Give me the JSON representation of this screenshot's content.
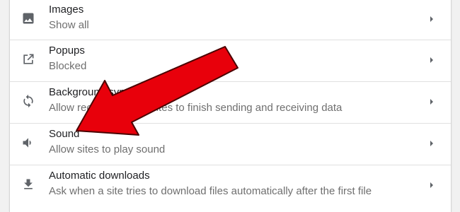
{
  "settings": {
    "items": [
      {
        "icon": "image-icon",
        "title": "Images",
        "subtitle": "Show all"
      },
      {
        "icon": "popup-icon",
        "title": "Popups",
        "subtitle": "Blocked"
      },
      {
        "icon": "sync-icon",
        "title": "Background sync",
        "subtitle": "Allow recently closed sites to finish sending and receiving data"
      },
      {
        "icon": "volume-icon",
        "title": "Sound",
        "subtitle": "Allow sites to play sound"
      },
      {
        "icon": "download-icon",
        "title": "Automatic downloads",
        "subtitle": "Ask when a site tries to download files automatically after the first file"
      }
    ]
  },
  "colors": {
    "arrow": "#e8000b",
    "arrow_outline": "#4a0000",
    "icon": "#5f6368",
    "title": "#202124",
    "subtitle": "#6f6f6f"
  }
}
